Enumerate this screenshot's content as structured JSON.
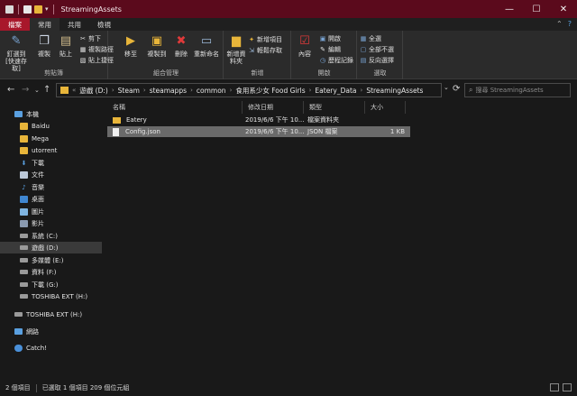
{
  "window": {
    "title": "StreamingAssets",
    "minimize": "—",
    "maximize": "☐",
    "close": "✕"
  },
  "tabs": [
    "檔案",
    "常用",
    "共用",
    "檢視"
  ],
  "ribbon": {
    "clipboard": {
      "label": "剪貼簿",
      "pin": "釘選到 [快速存取]",
      "copy": "複製",
      "paste": "貼上",
      "cut": "剪下",
      "copy_path": "複製路徑",
      "paste_shortcut": "貼上捷徑"
    },
    "organize": {
      "label": "組合管理",
      "move_to": "移至",
      "copy_to": "複製到",
      "delete": "刪除",
      "rename": "重新命名"
    },
    "new": {
      "label": "新增",
      "new_folder": "新增資料夾",
      "new_item": "新增項目",
      "easy_access": "輕鬆存取"
    },
    "open": {
      "label": "開啟",
      "properties": "內容",
      "open": "開啟",
      "edit": "編輯",
      "history": "歷程記錄"
    },
    "select": {
      "label": "選取",
      "select_all": "全選",
      "select_none": "全部不選",
      "invert": "反向選擇"
    }
  },
  "address": {
    "prefix": "«",
    "crumbs": [
      "遊戲 (D:)",
      "Steam",
      "steamapps",
      "common",
      "食用系少女 Food Girls",
      "Eatery_Data",
      "StreamingAssets"
    ],
    "search_placeholder": "搜尋 StreamingAssets"
  },
  "nav": {
    "items": [
      {
        "label": "本機",
        "icon": "computer-icon"
      },
      {
        "label": "Baidu",
        "icon": "folder-icon"
      },
      {
        "label": "Mega",
        "icon": "folder-icon"
      },
      {
        "label": "utorrent",
        "icon": "folder-icon"
      },
      {
        "label": "下載",
        "icon": "download-icon"
      },
      {
        "label": "文件",
        "icon": "document-icon"
      },
      {
        "label": "音樂",
        "icon": "music-icon"
      },
      {
        "label": "桌面",
        "icon": "desktop-icon"
      },
      {
        "label": "圖片",
        "icon": "pictures-icon"
      },
      {
        "label": "影片",
        "icon": "video-icon"
      },
      {
        "label": "系統 (C:)",
        "icon": "drive-icon"
      },
      {
        "label": "遊戲 (D:)",
        "icon": "drive-icon"
      },
      {
        "label": "多媒體 (E:)",
        "icon": "drive-icon"
      },
      {
        "label": "資料 (F:)",
        "icon": "drive-icon"
      },
      {
        "label": "下載 (G:)",
        "icon": "drive-icon"
      },
      {
        "label": "TOSHIBA EXT (H:)",
        "icon": "drive-icon"
      },
      {
        "label": "TOSHIBA EXT (H:)",
        "icon": "drive-icon"
      },
      {
        "label": "網路",
        "icon": "network-icon"
      },
      {
        "label": "Catch!",
        "icon": "catch-icon"
      }
    ]
  },
  "columns": {
    "name": "名稱",
    "modified": "修改日期",
    "type": "類型",
    "size": "大小"
  },
  "files": [
    {
      "name": "Eatery",
      "modified": "2019/6/6 下午 10...",
      "type": "檔案資料夾",
      "size": "",
      "icon": "folder-icon"
    },
    {
      "name": "Config.json",
      "modified": "2019/6/6 下午 10...",
      "type": "JSON 檔案",
      "size": "1 KB",
      "icon": "file-icon"
    }
  ],
  "status": {
    "count": "2 個項目",
    "selected": "已選取 1 個項目  209 個位元組"
  },
  "colors": {
    "titlebar": "#5b0a1c",
    "file_tab": "#a8172b",
    "folder": "#e8b53a"
  }
}
